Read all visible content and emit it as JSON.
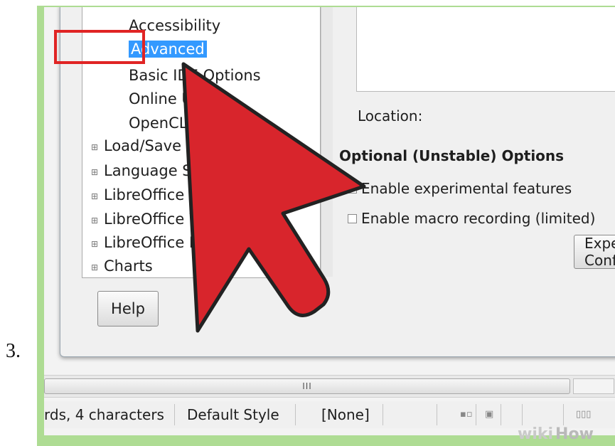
{
  "step_number": "3.",
  "tree": {
    "items": [
      {
        "label": "Accessibility",
        "type": "child"
      },
      {
        "label": "Advanced",
        "type": "child",
        "selected": true
      },
      {
        "label": "Basic IDE Options",
        "type": "child"
      },
      {
        "label": "Online Update",
        "type": "child"
      },
      {
        "label": "OpenCL",
        "type": "child"
      },
      {
        "label": "Load/Save",
        "type": "parent"
      },
      {
        "label": "Language Settings",
        "type": "parent"
      },
      {
        "label": "LibreOffice Writer",
        "type": "parent"
      },
      {
        "label": "LibreOffice Writer/Web",
        "type": "parent"
      },
      {
        "label": "LibreOffice Base",
        "type": "parent"
      },
      {
        "label": "Charts",
        "type": "parent"
      }
    ]
  },
  "buttons": {
    "help": "Help",
    "expert": "Expert Configuration"
  },
  "panel": {
    "location_label": "Location:",
    "optional_title": "Optional (Unstable) Options",
    "checkboxes": [
      {
        "label": "Enable experimental features",
        "checked": false
      },
      {
        "label": "Enable macro recording (limited)",
        "checked": false
      }
    ]
  },
  "scrollbar": {
    "thumb_grip": "III"
  },
  "statusbar": {
    "word_count": "rds, 4 characters",
    "page_style": "Default Style",
    "language": "[None]"
  },
  "watermark": {
    "wiki": "wiki",
    "how": "How"
  },
  "colors": {
    "selection": "#3399ff",
    "highlight_box": "#e02424",
    "cursor_fill": "#d8252c",
    "frame": "#aedc93"
  },
  "icons": {
    "tree_expand": "plus-box-icon",
    "cursor": "arrow-cursor-icon"
  }
}
